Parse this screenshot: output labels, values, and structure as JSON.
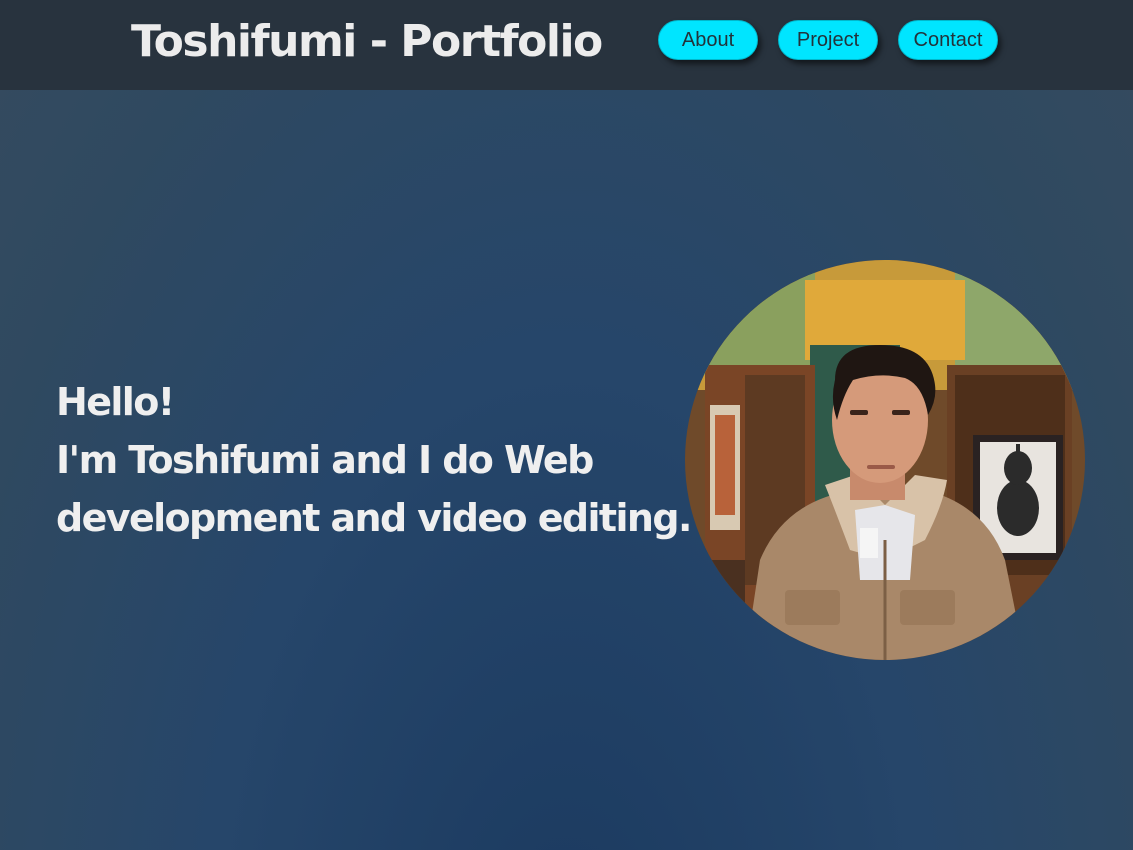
{
  "header": {
    "title": "Toshifumi - Portfolio",
    "nav": [
      {
        "label": "About"
      },
      {
        "label": "Project"
      },
      {
        "label": "Contact"
      }
    ]
  },
  "hero": {
    "lines": [
      "Hello!",
      "I'm Toshifumi and I do Web",
      "development and video editing."
    ],
    "photo": {
      "icon": "profile-photo",
      "shape": "circle"
    }
  },
  "colors": {
    "header_bg": "#28333e",
    "accent": "#00e5ff",
    "page_bg": "#26466a",
    "text": "#efefef"
  }
}
